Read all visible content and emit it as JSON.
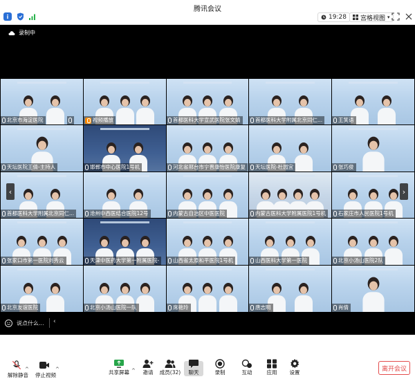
{
  "app_title": "腾讯会议",
  "clock": "19:28",
  "layout_label": "宫格视图",
  "recording_label": "录制中",
  "chat_placeholder": "说点什么...",
  "colors": {
    "accent": "#2a6fd6",
    "leave": "#e34b4b",
    "recording_badge": "#ff8a00",
    "signal": "#27b24a"
  },
  "participants": [
    {
      "name": "北京市海淀医院",
      "icon": "mic-off-icon"
    },
    {
      "name": "",
      "icon": "mic-off-icon"
    },
    {
      "name": "视频播放",
      "icon": "share-badge-icon"
    },
    {
      "name": "首都医科大学宣武医院张文婧",
      "icon": "mic-off-icon"
    },
    {
      "name": "首都医科大学附属北京同仁...",
      "icon": "mic-off-icon"
    },
    {
      "name": "王笑语",
      "icon": "mic-off-icon"
    },
    {
      "name": "天坛医院王倩-主持人",
      "icon": "mic-off-icon"
    },
    {
      "name": "邯郸市中心医院1号机",
      "icon": "mic-off-icon"
    },
    {
      "name": "河北省邢台市宁晋康怡医院康复",
      "icon": "mic-off-icon"
    },
    {
      "name": "天坛医院-杜园宜",
      "icon": "mic-off-icon"
    },
    {
      "name": "张巧俊",
      "icon": "mic-off-icon"
    },
    {
      "name": "首都医科大学附属北京同仁...",
      "icon": "mic-off-icon"
    },
    {
      "name": "沧州中西医结合医院12号",
      "icon": "mic-off-icon"
    },
    {
      "name": "内蒙古自治区中医医院",
      "icon": "mic-off-icon"
    },
    {
      "name": "内蒙古医科大学附属医院1号机",
      "icon": "mic-off-icon"
    },
    {
      "name": "石家庄市人民医院1号机",
      "icon": "mic-off-icon"
    },
    {
      "name": "张家口市第一医院刘秀云",
      "icon": "mic-off-icon"
    },
    {
      "name": "天津中医药大学第一附属医院-",
      "icon": "mic-off-icon"
    },
    {
      "name": "山西省太原和平医院1号机",
      "icon": "mic-off-icon"
    },
    {
      "name": "山西医科大学第一医院",
      "icon": "mic-off-icon"
    },
    {
      "name": "北京小汤山医院2队",
      "icon": "mic-off-icon"
    },
    {
      "name": "北京友谊医院",
      "icon": "mic-off-icon"
    },
    {
      "name": "北京小汤山医院一队",
      "icon": "mic-off-icon"
    },
    {
      "name": "席艳玲",
      "icon": "mic-off-icon"
    },
    {
      "name": "唐志明",
      "icon": "mic-off-icon"
    },
    {
      "name": "肖倩",
      "icon": "mic-off-icon"
    }
  ],
  "toolbar": {
    "unmute": "解除静音",
    "stop_video": "停止视频",
    "share_screen": "共享屏幕",
    "invite": "邀请",
    "members": "成员(32)",
    "chat": "聊天",
    "record": "录制",
    "interact": "互动",
    "apps": "应用",
    "settings": "设置",
    "leave": "离开会议"
  }
}
